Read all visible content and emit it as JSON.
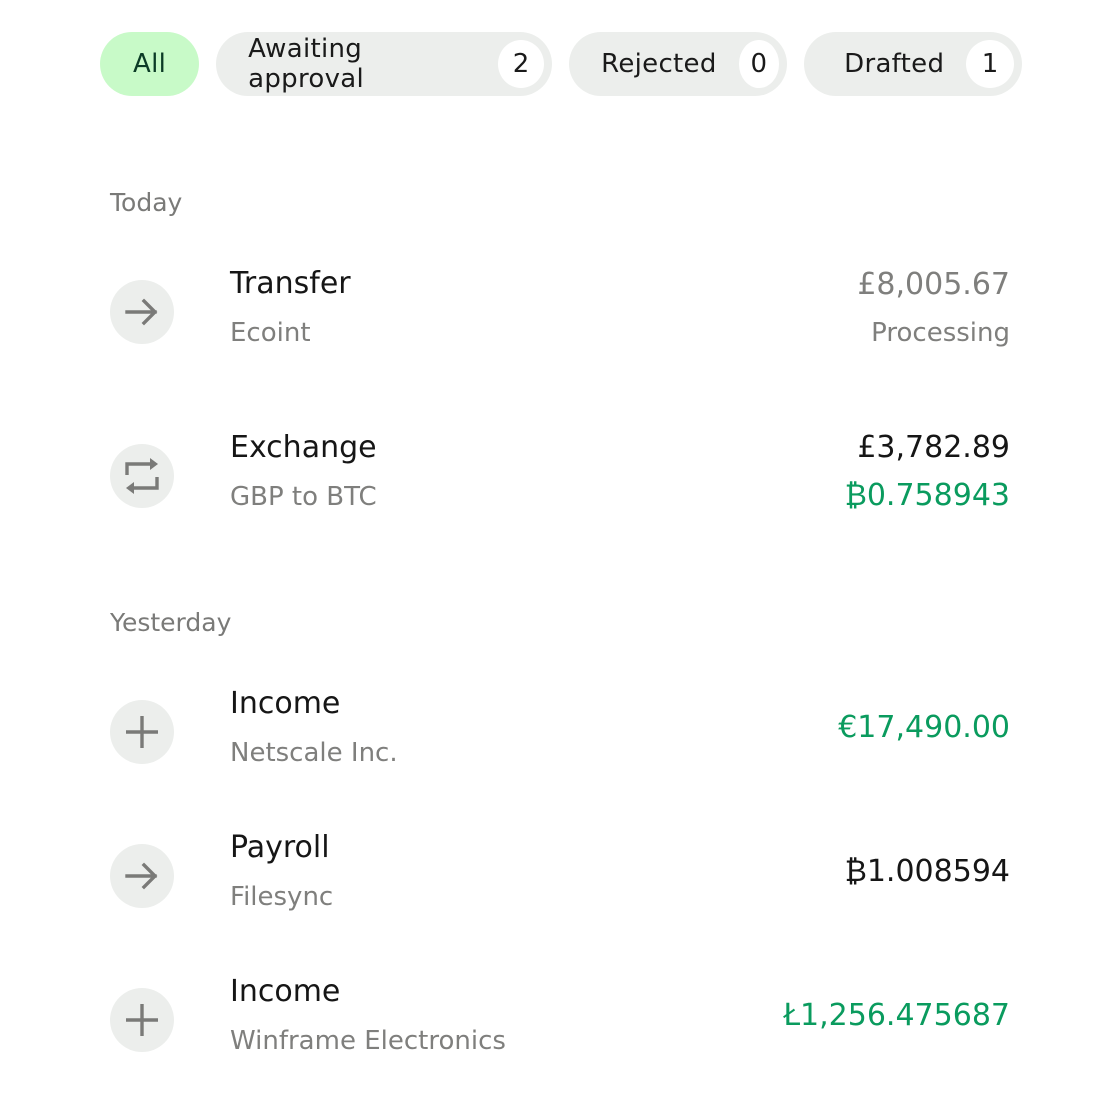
{
  "filters": [
    {
      "label": "All",
      "active": true
    },
    {
      "label": "Awaiting approval",
      "count": "2"
    },
    {
      "label": "Rejected",
      "count": "0"
    },
    {
      "label": "Drafted",
      "count": "1"
    }
  ],
  "sections": [
    {
      "label": "Today",
      "transactions": [
        {
          "icon": "arrow-right-icon",
          "title": "Transfer",
          "subtitle": "Ecoint",
          "amount": "£8,005.67",
          "amount_color": "#7f7f7d",
          "status": "Processing"
        },
        {
          "icon": "exchange-icon",
          "title": "Exchange",
          "subtitle": "GBP to BTC",
          "amount": "£3,782.89",
          "amount_color": "#161616",
          "secondary_amount": "₿0.758943",
          "secondary_amount_color": "#0a9b5e"
        }
      ]
    },
    {
      "label": "Yesterday",
      "transactions": [
        {
          "icon": "plus-icon",
          "title": "Income",
          "subtitle": "Netscale Inc.",
          "amount": "€17,490.00",
          "amount_color": "#0a9b5e"
        },
        {
          "icon": "arrow-right-icon",
          "title": "Payroll",
          "subtitle": "Filesync",
          "amount": "₿1.008594",
          "amount_color": "#161616"
        },
        {
          "icon": "plus-icon",
          "title": "Income",
          "subtitle": "Winframe Electronics",
          "amount": "Ł1,256.475687",
          "amount_color": "#0a9b5e"
        }
      ]
    }
  ],
  "colors": {
    "active_chip_bg": "#c8fac8",
    "active_chip_text": "#0b3b26",
    "chip_bg": "#eceeec",
    "positive": "#0a9b5e",
    "muted": "#7f7f7d"
  }
}
